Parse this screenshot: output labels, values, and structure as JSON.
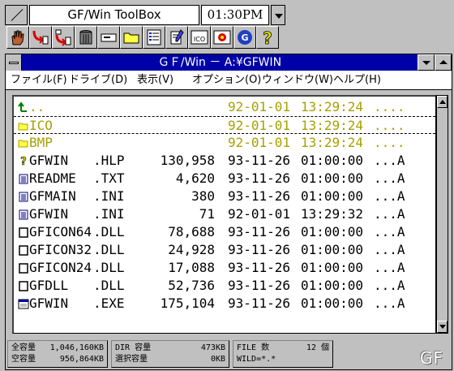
{
  "toolbox": {
    "title": "GF/Win ToolBox",
    "clock": "01:30PM",
    "tools": [
      {
        "icon": "hand-icon"
      },
      {
        "icon": "copy-file-icon"
      },
      {
        "icon": "move-file-icon"
      },
      {
        "icon": "trash-can-icon"
      },
      {
        "icon": "drive-icon"
      },
      {
        "icon": "folder-icon"
      },
      {
        "icon": "file-list-icon"
      },
      {
        "icon": "editor-icon"
      },
      {
        "icon": "ico-viewer-icon",
        "label": "ICO"
      },
      {
        "icon": "bmp-viewer-icon"
      },
      {
        "icon": "gf-icon"
      },
      {
        "icon": "help-icon"
      }
    ]
  },
  "window": {
    "title": "ＧＦ/Win － A:¥GFWIN",
    "menu": [
      "ファイル(F)",
      "ドライブ(D)",
      "表示(V)",
      "オプション(O)",
      "ウィンドウ(W)",
      "ヘルプ(H)"
    ]
  },
  "files": [
    {
      "icon": "parent-dir-icon",
      "name": "..",
      "ext": "",
      "size": "",
      "date": "92-01-01",
      "time": "13:29:24",
      "attr": "....",
      "type": "dir"
    },
    {
      "icon": "folder-icon",
      "name": "ICO",
      "ext": "",
      "size": "",
      "date": "92-01-01",
      "time": "13:29:24",
      "attr": "....",
      "type": "dir",
      "selected": true
    },
    {
      "icon": "folder-icon",
      "name": "BMP",
      "ext": "",
      "size": "",
      "date": "92-01-01",
      "time": "13:29:24",
      "attr": "....",
      "type": "dir"
    },
    {
      "icon": "help-file-icon",
      "name": "GFWIN",
      "ext": ".HLP",
      "size": "130,958",
      "date": "93-11-26",
      "time": "01:00:00",
      "attr": "...A",
      "type": "file"
    },
    {
      "icon": "text-file-icon",
      "name": "README",
      "ext": ".TXT",
      "size": "4,620",
      "date": "93-11-26",
      "time": "01:00:00",
      "attr": "...A",
      "type": "file"
    },
    {
      "icon": "text-file-icon",
      "name": "GFMAIN",
      "ext": ".INI",
      "size": "380",
      "date": "93-11-26",
      "time": "01:00:00",
      "attr": "...A",
      "type": "file"
    },
    {
      "icon": "text-file-icon",
      "name": "GFWIN",
      "ext": ".INI",
      "size": "71",
      "date": "92-01-01",
      "time": "13:29:32",
      "attr": "...A",
      "type": "file"
    },
    {
      "icon": "dll-file-icon",
      "name": "GFICON64",
      "ext": ".DLL",
      "size": "78,688",
      "date": "93-11-26",
      "time": "01:00:00",
      "attr": "...A",
      "type": "file"
    },
    {
      "icon": "dll-file-icon",
      "name": "GFICON32",
      "ext": ".DLL",
      "size": "24,928",
      "date": "93-11-26",
      "time": "01:00:00",
      "attr": "...A",
      "type": "file"
    },
    {
      "icon": "dll-file-icon",
      "name": "GFICON24",
      "ext": ".DLL",
      "size": "17,088",
      "date": "93-11-26",
      "time": "01:00:00",
      "attr": "...A",
      "type": "file"
    },
    {
      "icon": "dll-file-icon",
      "name": "GFDLL",
      "ext": ".DLL",
      "size": "52,736",
      "date": "93-11-26",
      "time": "01:00:00",
      "attr": "...A",
      "type": "file"
    },
    {
      "icon": "exe-file-icon",
      "name": "GFWIN",
      "ext": ".EXE",
      "size": "175,104",
      "date": "93-11-26",
      "time": "01:00:00",
      "attr": "...A",
      "type": "file"
    }
  ],
  "status": {
    "total_label": "全容量",
    "total_value": "1,046,160KB",
    "free_label": "空容量",
    "free_value": "956,864KB",
    "dir_label": "DIR 容量",
    "dir_value": "473KB",
    "sel_label": "選択容量",
    "sel_value": "0KB",
    "files_label": "FILE 数",
    "files_value": "12 個",
    "wild": "WILD=*.*",
    "logo": "GF"
  },
  "colors": {
    "titlebar": "#0000a8",
    "directory_text": "#a8a000",
    "window_face": "#c0c0c0"
  }
}
